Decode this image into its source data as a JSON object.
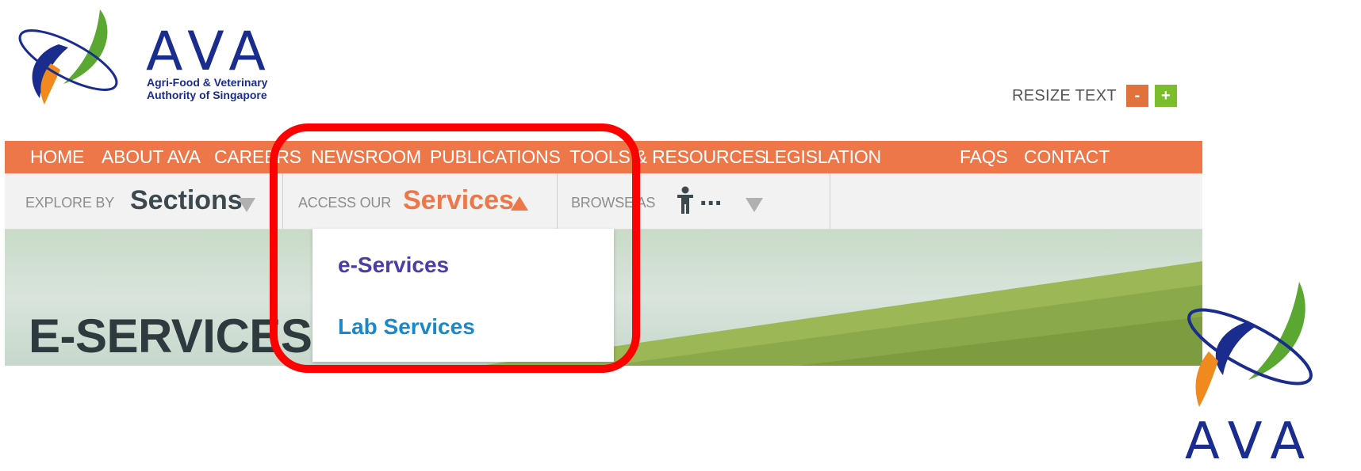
{
  "logo": {
    "letters": "AVA",
    "subtitle_line1": "Agri-Food & Veterinary",
    "subtitle_line2": "Authority of Singapore",
    "icon": "ava-leaf-logo-icon",
    "colors": {
      "blue": "#1b2c8f",
      "green": "#5aa832",
      "orange": "#f08a1e"
    }
  },
  "resize": {
    "label": "RESIZE TEXT",
    "minus": "-",
    "plus": "+"
  },
  "topnav": {
    "items": [
      "HOME",
      "ABOUT AVA",
      "CAREERS",
      "NEWSROOM",
      "PUBLICATIONS",
      "TOOLS & RESOURCES",
      "LEGISLATION",
      "FAQS",
      "CONTACT"
    ]
  },
  "subnav": {
    "explore_prefix": "EXPLORE BY",
    "explore_value": "Sections",
    "access_prefix": "ACCESS OUR",
    "access_value": "Services",
    "browse_prefix": "BROWSE AS",
    "browse_value": "...",
    "browse_icon": "person-icon"
  },
  "dropdown": {
    "items": [
      "e-Services",
      "Lab Services"
    ]
  },
  "hero": {
    "title": "E-SERVICES"
  },
  "corner_logo": {
    "letters": "AVA"
  },
  "colors": {
    "nav_orange": "#ee7749",
    "highlight_red": "#ff0000",
    "link_purple": "#4b3ca8",
    "link_blue": "#1b89c9"
  }
}
